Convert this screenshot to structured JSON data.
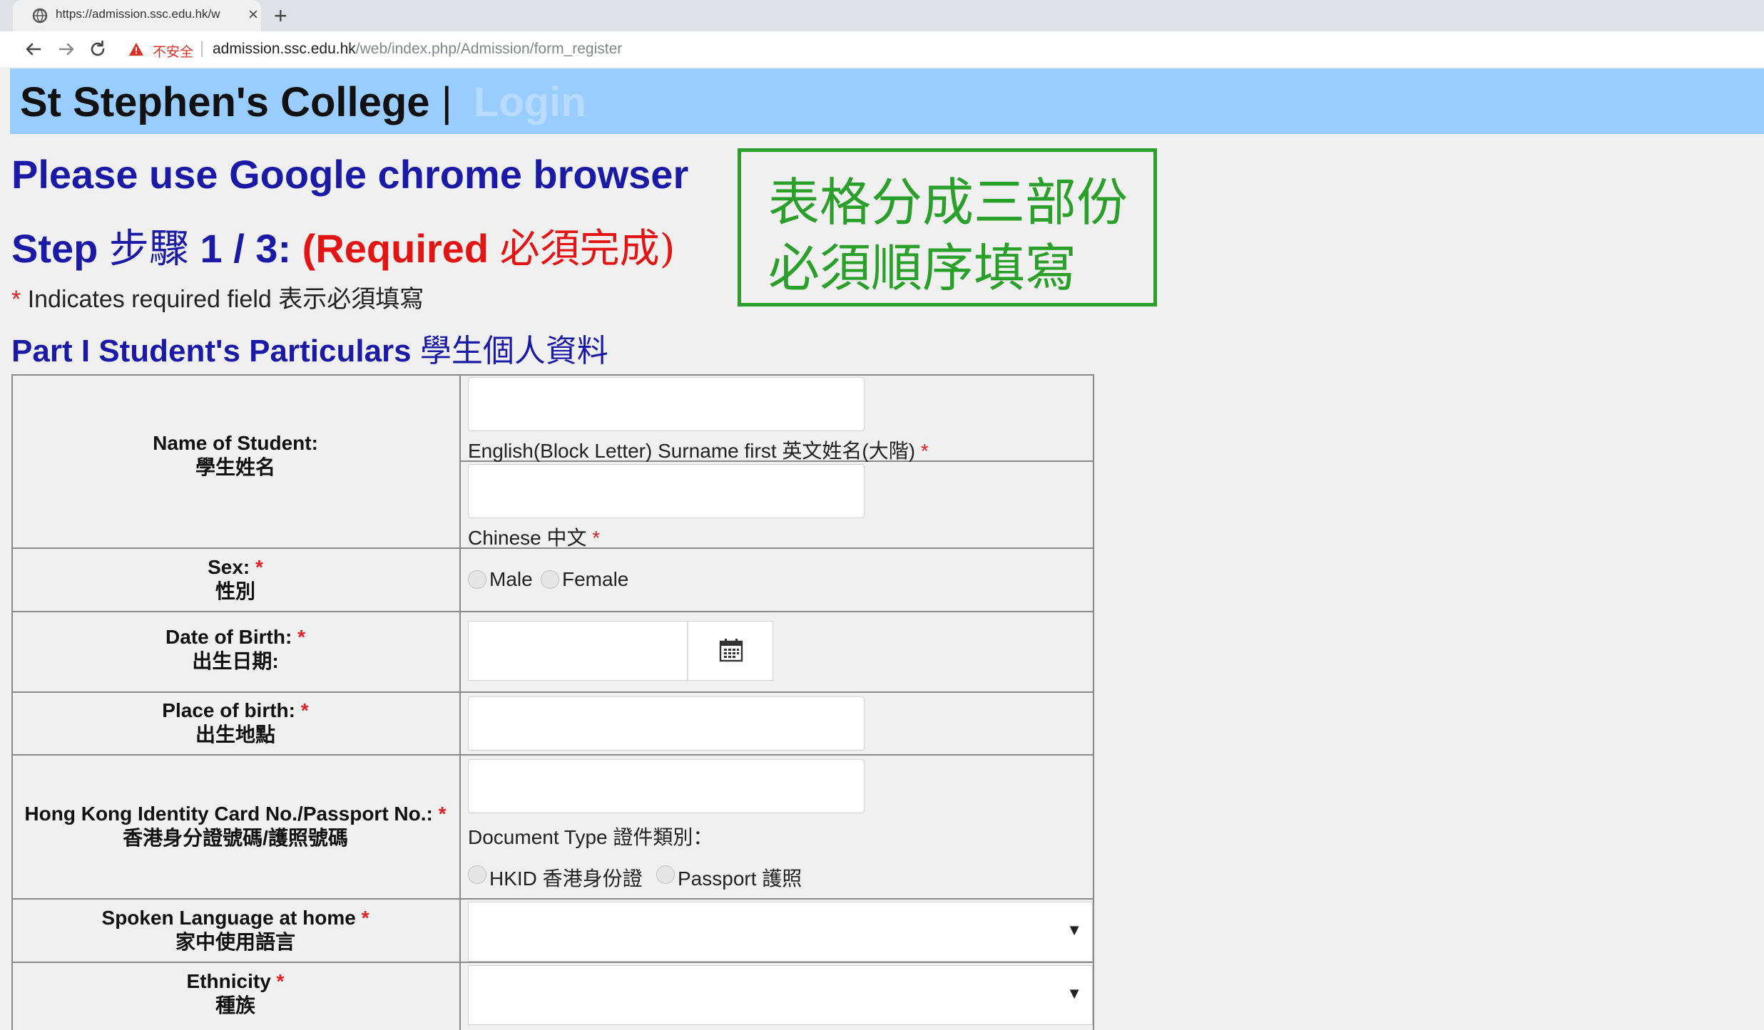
{
  "browser": {
    "tab_title": "https://admission.ssc.edu.hk/w",
    "tab_close": "×",
    "new_tab": "+",
    "not_secure": "不安全",
    "url_host": "admission.ssc.edu.hk",
    "url_path": "/web/index.php/Admission/form_register"
  },
  "header": {
    "site_title": "St Stephen's College",
    "separator": "|",
    "login_link": "Login"
  },
  "intro": {
    "browser_notice": "Please use Google chrome browser",
    "step_prefix": "Step",
    "step_zh": "步驟",
    "step_count": "1 / 3:",
    "step_required": "(Required",
    "step_required_zh": "必須完成)",
    "required_star": "*",
    "required_note": "Indicates required field 表示必須填寫"
  },
  "notice_box": {
    "line1": "表格分成三部份",
    "line2": "必須順序填寫"
  },
  "part1": {
    "title_en": "Part I Student's Particulars",
    "title_zh": "學生個人資料"
  },
  "form": {
    "name": {
      "label_en": "Name of Student:",
      "label_zh": "學生姓名",
      "english_value": "",
      "english_hint": "English(Block Letter) Surname first 英文姓名(大階)",
      "chinese_value": "",
      "chinese_hint": "Chinese 中文"
    },
    "sex": {
      "label_en": "Sex:",
      "label_zh": "性別",
      "option_male": "Male",
      "option_female": "Female"
    },
    "dob": {
      "label_en": "Date of Birth:",
      "label_zh": "出生日期:",
      "value": ""
    },
    "pob": {
      "label_en": "Place of birth:",
      "label_zh": "出生地點",
      "value": ""
    },
    "id": {
      "label_en": "Hong Kong Identity Card No./Passport No.:",
      "label_zh": "香港身分證號碼/護照號碼",
      "value": "",
      "doc_type_label": "Document Type 證件類別：",
      "option_hkid": "HKID 香港身份證",
      "option_passport": "Passport 護照"
    },
    "language": {
      "label_en": "Spoken Language at home",
      "label_zh": "家中使用語言",
      "selected": ""
    },
    "ethnicity": {
      "label_en": "Ethnicity",
      "label_zh": "種族",
      "selected": ""
    },
    "required_star": "*",
    "select_arrow": "▼"
  },
  "colors": {
    "banner": "#99ccff",
    "heading_blue": "#1a1aa6",
    "required_red": "#e21414",
    "notice_green": "#2aa02a"
  },
  "icons": [
    "globe-icon",
    "back-icon",
    "forward-icon",
    "reload-icon",
    "warning-icon",
    "calendar-icon",
    "dropdown-arrow-icon"
  ]
}
